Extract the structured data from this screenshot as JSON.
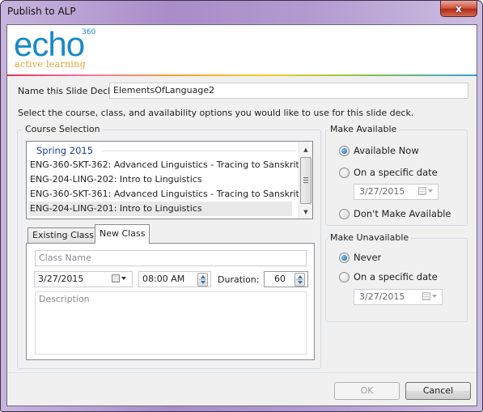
{
  "window": {
    "title": "Publish to ALP",
    "close_label": "x"
  },
  "branding": {
    "logo_word": "echo",
    "logo_superscript": "360",
    "tagline": "active learning",
    "colors": {
      "brand_blue": "#1a88c9",
      "tagline_gold": "#e3a22a"
    }
  },
  "name_field": {
    "label": "Name this Slide Deck:",
    "value": "ElementsOfLanguage2"
  },
  "instruction": "Select the course, class, and availability options you would like to use for this slide deck.",
  "course_selection": {
    "title": "Course Selection",
    "term_header": "Spring 2015",
    "courses": [
      {
        "label": "ENG-360-SKT-362: Advanced Linguistics - Tracing to Sanskrit",
        "selected": false
      },
      {
        "label": "ENG-204-LING-202: Intro to Linguistics",
        "selected": false
      },
      {
        "label": "ENG-360-SKT-361: Advanced Linguistics - Tracing to Sanskrit",
        "selected": false
      },
      {
        "label": "ENG-204-LING-201: Intro to Linguistics",
        "selected": true
      }
    ]
  },
  "class_tabs": {
    "tabs": [
      {
        "label": "Existing Class",
        "active": false
      },
      {
        "label": "New Class",
        "active": true
      }
    ],
    "new_class": {
      "class_name_placeholder": "Class Name",
      "date": "3/27/2015",
      "time": "08:00 AM",
      "duration_label": "Duration:",
      "duration": "60",
      "description_placeholder": "Description"
    }
  },
  "make_available": {
    "title": "Make Available",
    "options": [
      {
        "label": "Available Now",
        "checked": true
      },
      {
        "label": "On a specific date",
        "checked": false
      },
      {
        "label": "Don't Make Available",
        "checked": false
      }
    ],
    "date": "3/27/2015"
  },
  "make_unavailable": {
    "title": "Make Unavailable",
    "options": [
      {
        "label": "Never",
        "checked": true
      },
      {
        "label": "On a specific date",
        "checked": false
      }
    ],
    "date": "3/27/2015"
  },
  "footer": {
    "ok_label": "OK",
    "cancel_label": "Cancel"
  }
}
